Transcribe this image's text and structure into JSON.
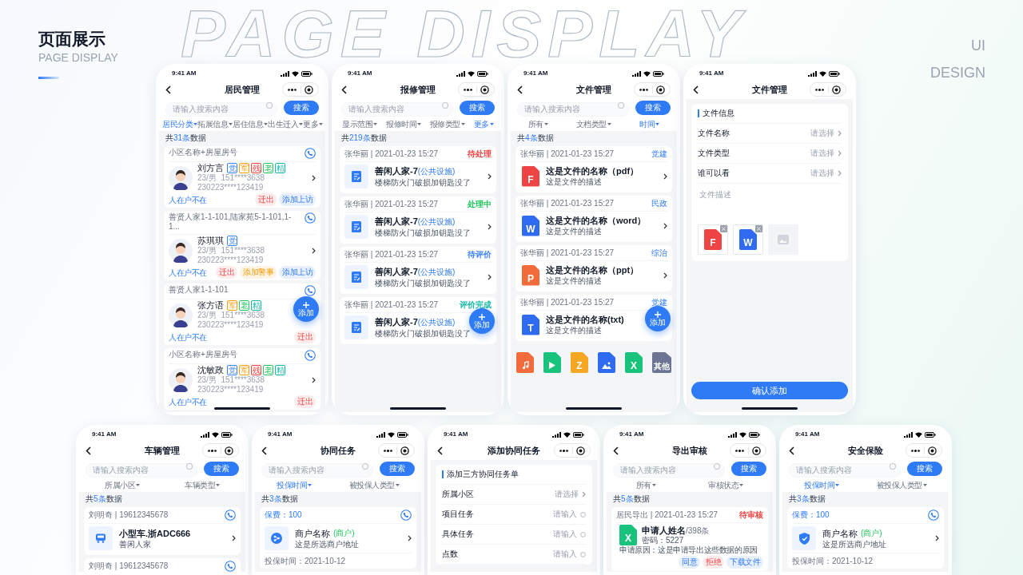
{
  "header": {
    "title": "页面展示",
    "subtitle": "PAGE DISPLAY",
    "backdrop_text": "PAGE DISPLAY",
    "side_text": [
      "UI",
      "DESIGN"
    ]
  },
  "top_row": [
    {
      "kind": "residents",
      "time": "9:41 AM",
      "title": "居民管理",
      "search": {
        "placeholder": "请输入搜索内容",
        "button": "搜索"
      },
      "filters": [
        {
          "label": "居民分类",
          "selected": true
        },
        {
          "label": "拓展信息",
          "selected": false
        },
        {
          "label": "居住信息",
          "selected": false
        },
        {
          "label": "出生迁入",
          "selected": false
        },
        {
          "label": "更多",
          "selected": false
        }
      ],
      "count": {
        "before": "共",
        "number": "31条",
        "after": "数据"
      },
      "items": [
        {
          "address": "小区名称+房屋房号",
          "name": "刘方言",
          "tags": [
            {
              "label": "党",
              "color": "#3b82f6"
            },
            {
              "label": "军",
              "color": "#f59e0b"
            },
            {
              "label": "残",
              "color": "#ef4444"
            },
            {
              "label": "老",
              "color": "#22c55e"
            },
            {
              "label": "精",
              "color": "#14b8a6"
            }
          ],
          "info": "23/男  151****3638",
          "id": "230223****123419",
          "status": "人在户不在",
          "actions": [
            {
              "label": "迁出",
              "kind": "danger"
            },
            {
              "label": "添加上访",
              "kind": "primary"
            }
          ]
        },
        {
          "address": "善贤人家1-1-101,陆家苑5-1-101,1-1...",
          "name": "苏琪琪",
          "tags": [
            {
              "label": "党",
              "color": "#3b82f6"
            }
          ],
          "info": "23/男  151****3638",
          "id": "230223****123419",
          "status": "人在户不在",
          "actions": [
            {
              "label": "迁出",
              "kind": "danger"
            },
            {
              "label": "添加警事",
              "kind": "warning"
            },
            {
              "label": "添加上访",
              "kind": "primary"
            }
          ]
        },
        {
          "address": "善贤人家1-1-101",
          "name": "张方语",
          "tags": [
            {
              "label": "军",
              "color": "#f59e0b"
            },
            {
              "label": "老",
              "color": "#22c55e"
            },
            {
              "label": "精",
              "color": "#14b8a6"
            }
          ],
          "info": "23/男  151****3638",
          "id": "230223****123419",
          "status": "人在户不在",
          "actions": [
            {
              "label": "迁出",
              "kind": "danger"
            }
          ]
        },
        {
          "address": "小区名称+房屋房号",
          "name": "沈敏政",
          "tags": [
            {
              "label": "党",
              "color": "#3b82f6"
            },
            {
              "label": "军",
              "color": "#f59e0b"
            },
            {
              "label": "残",
              "color": "#ef4444"
            },
            {
              "label": "老",
              "color": "#22c55e"
            },
            {
              "label": "精",
              "color": "#14b8a6"
            }
          ],
          "info": "23/男  151****3638",
          "id": "230223****123419",
          "status": "人在户不在",
          "actions": [
            {
              "label": "迁出",
              "kind": "danger"
            }
          ]
        }
      ],
      "fab": {
        "label": "添加"
      }
    },
    {
      "kind": "repairs",
      "time": "9:41 AM",
      "title": "报修管理",
      "search": {
        "placeholder": "请输入搜索内容",
        "button": "搜索"
      },
      "filters": [
        {
          "label": "显示范围",
          "selected": false
        },
        {
          "label": "报修时间",
          "selected": false
        },
        {
          "label": "报修类型",
          "selected": false
        },
        {
          "label": "更多",
          "selected": true
        }
      ],
      "count": {
        "before": "共",
        "number": "219条",
        "after": "数据"
      },
      "items": [
        {
          "meta": "张华丽 | 2021-01-23 15:27",
          "status": "待处理",
          "color": "#ef4444",
          "title": "善闲人家-7",
          "category": "(公共设施)",
          "desc": "楼梯防火门破损加钥匙没了",
          "chevron": true
        },
        {
          "meta": "张华丽 | 2021-01-23 15:27",
          "status": "处理中",
          "color": "#22c55e",
          "title": "善闲人家-7",
          "category": "(公共设施)",
          "desc": "楼梯防火门破损加钥匙没了",
          "chevron": true
        },
        {
          "meta": "张华丽 | 2021-01-23 15:27",
          "status": "待评价",
          "color": "#3b82f6",
          "title": "善闲人家-7",
          "category": "(公共设施)",
          "desc": "楼梯防火门破损加钥匙没了",
          "chevron": true
        },
        {
          "meta": "张华丽 | 2021-01-23 15:27",
          "status": "评价完成",
          "color": "#14b8a6",
          "title": "善闲人家-7",
          "category": "(公共设施)",
          "desc": "楼梯防火门破损加钥匙没了",
          "chevron": false
        }
      ],
      "fab": {
        "label": "添加"
      }
    },
    {
      "kind": "files",
      "time": "9:41 AM",
      "title": "文件管理",
      "search": {
        "placeholder": "请输入搜索内容",
        "button": "搜索"
      },
      "filters": [
        {
          "label": "所有",
          "selected": false
        },
        {
          "label": "文档类型",
          "selected": false
        },
        {
          "label": "时间",
          "selected": true
        }
      ],
      "count": {
        "before": "共",
        "number": "4条",
        "after": "数据"
      },
      "items": [
        {
          "meta": "张华丽 | 2021-01-23 15:27",
          "status": "党建",
          "letter": "F",
          "color": "#ef4444",
          "title": "这是文件的名称（pdf）",
          "desc": "这是文件的描述",
          "chevron": true
        },
        {
          "meta": "张华丽 | 2021-01-23 15:27",
          "status": "民政",
          "letter": "W",
          "color": "#2f6bf0",
          "title": "这是文件的名称（word）",
          "desc": "这是文件的描述",
          "chevron": true
        },
        {
          "meta": "张华丽 | 2021-01-23 15:27",
          "status": "综治",
          "letter": "P",
          "color": "#f26b3a",
          "title": "这是文件的名称（ppt）",
          "desc": "这是文件的描述",
          "chevron": true
        },
        {
          "meta": "张华丽 | 2021-01-23 15:27",
          "status": "党建",
          "letter": "T",
          "color": "#2f6bf0",
          "title": "这是文件的名称(txt)",
          "desc": "这是文件的描述",
          "chevron": false
        }
      ],
      "file_types": [
        {
          "kind": "music",
          "color": "#f26b3a"
        },
        {
          "kind": "video",
          "color": "#19c37d"
        },
        {
          "kind": "zip",
          "letter": "Z",
          "color": "#f5a623"
        },
        {
          "kind": "image",
          "color": "#2f6bf0"
        },
        {
          "kind": "excel",
          "letter": "X",
          "color": "#19c37d"
        },
        {
          "kind": "other",
          "letter": "其他",
          "color": "#6b7593"
        }
      ],
      "fab": {
        "label": "添加"
      }
    },
    {
      "kind": "file_form",
      "time": "9:41 AM",
      "title": "文件管理",
      "section": "文件信息",
      "rows": [
        {
          "label": "文件名称",
          "value": "请选择",
          "kind": "select"
        },
        {
          "label": "文件类型",
          "value": "请选择",
          "kind": "select"
        },
        {
          "label": "谁可以看",
          "value": "请选择",
          "kind": "select"
        }
      ],
      "description": {
        "placeholder": "文件描述"
      },
      "attachments": [
        {
          "kind": "file",
          "letter": "F",
          "color": "#ef4444"
        },
        {
          "kind": "file",
          "letter": "W",
          "color": "#2f6bf0"
        },
        {
          "kind": "upload"
        }
      ],
      "submit": "确认添加"
    }
  ],
  "bottom_row": [
    {
      "kind": "vehicles",
      "time": "9:41 AM",
      "title": "车辆管理",
      "search": {
        "placeholder": "请输入搜索内容",
        "button": "搜索"
      },
      "filters": [
        {
          "label": "所属小区",
          "selected": false
        },
        {
          "label": "车辆类型",
          "selected": false
        }
      ],
      "count": {
        "before": "共",
        "number": "5条",
        "after": "数据"
      },
      "items": [
        {
          "meta": "刘明奇 | 19612345678",
          "title": "小型车.浙ADC666",
          "desc": "善闲人家"
        },
        {
          "meta": "刘明奇 | 19612345678"
        }
      ]
    },
    {
      "kind": "insurance",
      "time": "9:41 AM",
      "title": "协同任务",
      "search": {
        "placeholder": "请输入搜索内容",
        "button": "搜索"
      },
      "filters": [
        {
          "label": "投保时间",
          "selected": true
        },
        {
          "label": "被投保人类型",
          "selected": false
        }
      ],
      "count": {
        "before": "共",
        "number": "3条",
        "after": "数据"
      },
      "items": [
        {
          "fee": "保费：100",
          "kind": "share",
          "name": "商户名称",
          "tag": "(商户)",
          "address": "这是所选商户地址",
          "date": "投保时间：2021-10-12"
        }
      ]
    },
    {
      "kind": "task_form",
      "time": "9:41 AM",
      "title": "添加协同任务",
      "section": "添加三方协同任务单",
      "rows": [
        {
          "label": "所属小区",
          "value": "请选择",
          "kind": "select"
        },
        {
          "label": "项目任务",
          "value": "请输入",
          "kind": "input"
        },
        {
          "label": "具体任务",
          "value": "请输入",
          "kind": "input"
        },
        {
          "label": "点数",
          "value": "请输入",
          "kind": "input"
        }
      ]
    },
    {
      "kind": "exports",
      "time": "9:41 AM",
      "title": "导出审核",
      "search": {
        "placeholder": "请输入搜索内容",
        "button": "搜索"
      },
      "filters": [
        {
          "label": "所有",
          "selected": false
        },
        {
          "label": "审核状态",
          "selected": false
        }
      ],
      "count": {
        "before": "共",
        "number": "5条",
        "after": "数据"
      },
      "items": [
        {
          "meta": "居民导出 | 2021-01-23 15:27",
          "status": "待审核",
          "color": "#ef4444",
          "letter": "X",
          "name": "申请人姓名",
          "count": "/398条",
          "password": "密码：5227",
          "reason": "申请原因：这是申请导出这些数据的原因",
          "actions": [
            {
              "label": "同意",
              "kind": "primary"
            },
            {
              "label": "拒绝",
              "kind": "danger"
            },
            {
              "label": "下载文件",
              "kind": "primary"
            }
          ]
        }
      ]
    },
    {
      "kind": "insurance",
      "time": "9:41 AM",
      "title": "安全保险",
      "search": {
        "placeholder": "请输入搜索内容",
        "button": "搜索"
      },
      "filters": [
        {
          "label": "投保时间",
          "selected": true
        },
        {
          "label": "被投保人类型",
          "selected": false
        }
      ],
      "count": {
        "before": "共",
        "number": "3条",
        "after": "数据"
      },
      "items": [
        {
          "fee": "保费：100",
          "kind": "shield",
          "name": "商户名称",
          "tag": "(商户)",
          "address": "这是所选商户地址",
          "date": "投保时间：2021-10-12"
        }
      ]
    }
  ]
}
